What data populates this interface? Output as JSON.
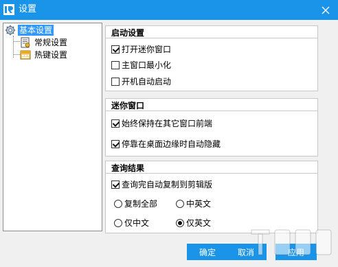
{
  "window": {
    "title": "设置"
  },
  "tree": {
    "items": [
      {
        "label": "基本设置",
        "icon": "gear-icon"
      },
      {
        "label": "常规设置",
        "icon": "document-settings-icon"
      },
      {
        "label": "热键设置",
        "icon": "keyboard-icon"
      }
    ]
  },
  "groups": {
    "startup": {
      "title": "启动设置",
      "options": [
        {
          "label": "打开迷你窗口",
          "checked": true
        },
        {
          "label": "主窗口最小化",
          "checked": false
        },
        {
          "label": "开机自动启动",
          "checked": false
        }
      ]
    },
    "mini": {
      "title": "迷你窗口",
      "options": [
        {
          "label": "始终保持在其它窗口前端",
          "checked": true
        },
        {
          "label": "停靠在桌面边缘时自动隐藏",
          "checked": true
        }
      ]
    },
    "result": {
      "title": "查询结果",
      "checkbox": {
        "label": "查询完自动复制到剪辑版",
        "checked": true
      },
      "radios": [
        {
          "label": "复制全部",
          "checked": false
        },
        {
          "label": "中英文",
          "checked": false
        },
        {
          "label": "仅中文",
          "checked": false
        },
        {
          "label": "仅英文",
          "checked": true
        }
      ]
    }
  },
  "buttons": {
    "ok": "确定",
    "cancel": "取消",
    "apply": "应用"
  },
  "colors": {
    "titlebar": "#1a94e8",
    "button": "#1a94e8",
    "selection": "#3399ff"
  }
}
